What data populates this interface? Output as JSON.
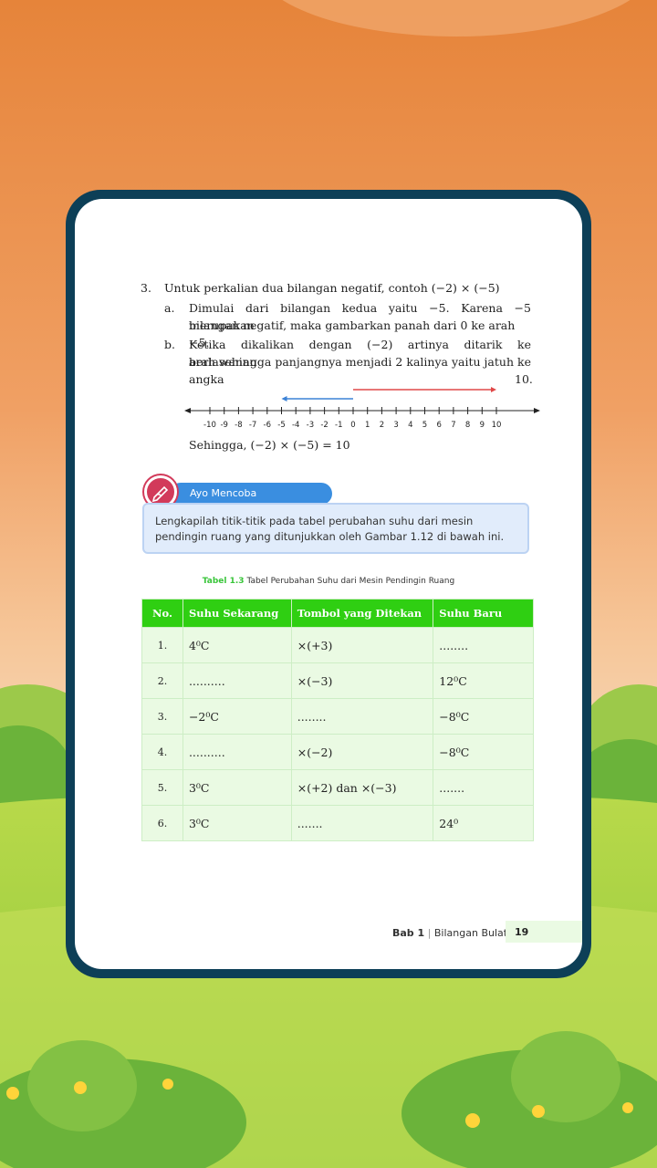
{
  "item3": {
    "number": "3.",
    "text": "Untuk perkalian dua bilangan negatif, contoh (−2) × (−5)",
    "a_label": "a.",
    "a_line1": "Dimulai dari bilangan kedua yaitu −5. Karena −5 merupakan",
    "a_line2": "bilangan negatif, maka gambarkan panah dari 0 ke arah −5.",
    "b_label": "b.",
    "b_line1": "Ketika dikalikan dengan (−2) artinya ditarik ke berlawanan",
    "b_line2": "arah sehingga panjangnya menjadi 2 kalinya yaitu jatuh ke",
    "b_line3_left": "angka",
    "b_line3_right": "10.",
    "conclusion": "Sehingga, (−2) × (−5) = 10"
  },
  "number_line": {
    "ticks": [
      "-10",
      "-9",
      "-8",
      "-7",
      "-6",
      "-5",
      "-4",
      "-3",
      "-2",
      "-1",
      "0",
      "1",
      "2",
      "3",
      "4",
      "5",
      "6",
      "7",
      "8",
      "9",
      "10"
    ],
    "blue_arrow": {
      "from": 0,
      "to": -5,
      "color": "#3b82d6"
    },
    "red_arrow": {
      "from": 0,
      "to": 10,
      "color": "#e04848"
    }
  },
  "activity": {
    "badge_label": "Ayo Mencoba",
    "instruction": "Lengkapilah titik-titik pada tabel perubahan suhu dari mesin pendingin ruang yang ditunjukkan oleh Gambar 1.12 di bawah ini."
  },
  "table": {
    "caption_label": "Tabel 1.3",
    "caption_text": "Tabel Perubahan Suhu dari Mesin Pendingin Ruang",
    "headers": [
      "No.",
      "Suhu Sekarang",
      "Tombol yang Ditekan",
      "Suhu Baru"
    ],
    "rows": [
      [
        "1.",
        "4⁰C",
        "×(+3)",
        "........"
      ],
      [
        "2.",
        "..........",
        "×(−3)",
        "12⁰C"
      ],
      [
        "3.",
        "−2⁰C",
        "........",
        "−8⁰C"
      ],
      [
        "4.",
        "..........",
        "×(−2)",
        "−8⁰C"
      ],
      [
        "5.",
        "3⁰C",
        "×(+2) dan ×(−3)",
        "......."
      ],
      [
        "6.",
        "3⁰C",
        ".......",
        "24⁰"
      ]
    ]
  },
  "footer": {
    "chapter": "Bab 1",
    "separator": "|",
    "title": "Bilangan Bulat",
    "page": "19"
  },
  "colors": {
    "frame": "#0d3f57",
    "table_header": "#2fcf12",
    "badge": "#3a8ee0"
  }
}
